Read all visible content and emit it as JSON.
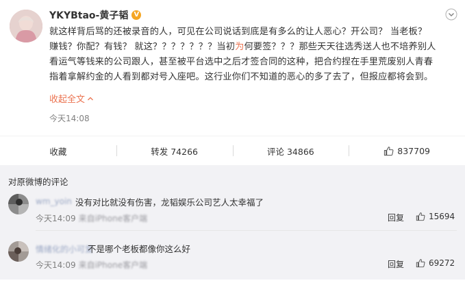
{
  "post": {
    "username": "YKYBtao-黄子韬",
    "verified_badge": "V",
    "text_lines": [
      "就这样背后骂的还被录音的人，可见在公司说话到底是有多么的让人恶心？开公司？ 当老板？",
      "赚钱？你配？有钱？ 就这？？？？？？？当初",
      "何要签？？？那些天天往选秀送人也不培养别人",
      "看运气等钱来的公司跟人，甚至被平台选中之后才签合同的这种，把合约捏在手里荒废别人青春",
      "指着拿解约金的人看到都对号入座吧。这行业你们不知道的恶心的多了去了，但报应都将会到。"
    ],
    "highlight_char": "为",
    "collapse_label": "收起全文",
    "time": "今天14:08"
  },
  "actions": {
    "favorite_label": "收藏",
    "repost_label": "转发 74266",
    "comment_label": "评论 34866",
    "like_count": "837709"
  },
  "comments": {
    "title": "对原微博的评论",
    "items": [
      {
        "name": "wm_yoin",
        "text": "没有对比就没有伤害，龙韬娱乐公司艺人太幸福了",
        "time": "今天14:09",
        "source": "来自iPhone客户端",
        "reply_label": "回复",
        "likes": "15694"
      },
      {
        "name": "情绪化的小可爱",
        "text": "不是哪个老板都像你这么好",
        "time": "今天14:09",
        "source": "来自iPhone客户端",
        "reply_label": "回复",
        "likes": "69272"
      }
    ]
  },
  "colors": {
    "accent": "#eb7350",
    "verified": "#f5a623",
    "comment_bg": "#f2f2f5"
  },
  "icons": [
    "more-chevron-icon",
    "collapse-chevron-up-icon",
    "thumb-up-icon"
  ]
}
